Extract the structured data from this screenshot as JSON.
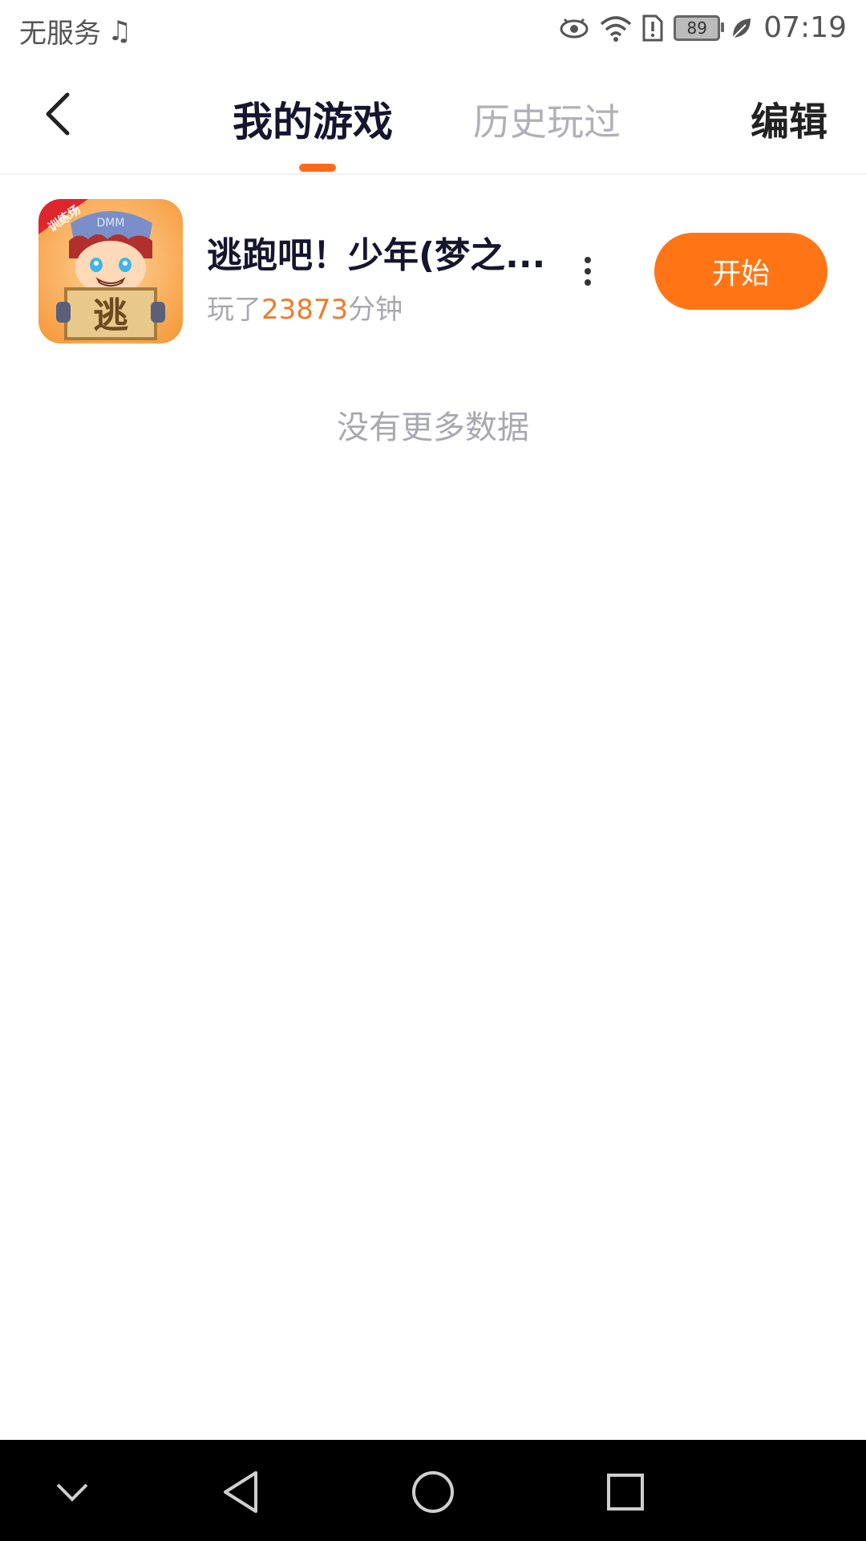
{
  "status_bar": {
    "carrier": "无服务",
    "battery_level": "89",
    "time": "07:19",
    "icons": [
      "music-icon",
      "eye-icon",
      "wifi-icon",
      "sim-alert-icon",
      "battery-icon",
      "leaf-icon"
    ]
  },
  "header": {
    "tab_active": "我的游戏",
    "tab_inactive": "历史玩过",
    "edit_label": "编辑",
    "accent_color": "#ff6a1a"
  },
  "game": {
    "title": "逃跑吧！少年(梦之...",
    "played_prefix": "玩了",
    "played_minutes": "23873",
    "played_suffix": "分钟",
    "start_label": "开始",
    "icon_badge": "训练场",
    "icon_brand": "DMM",
    "icon_sign": "逃"
  },
  "footer_text": "没有更多数据",
  "nav_bar": {
    "buttons": [
      "collapse-icon",
      "back-triangle-icon",
      "home-circle-icon",
      "recents-square-icon"
    ]
  }
}
